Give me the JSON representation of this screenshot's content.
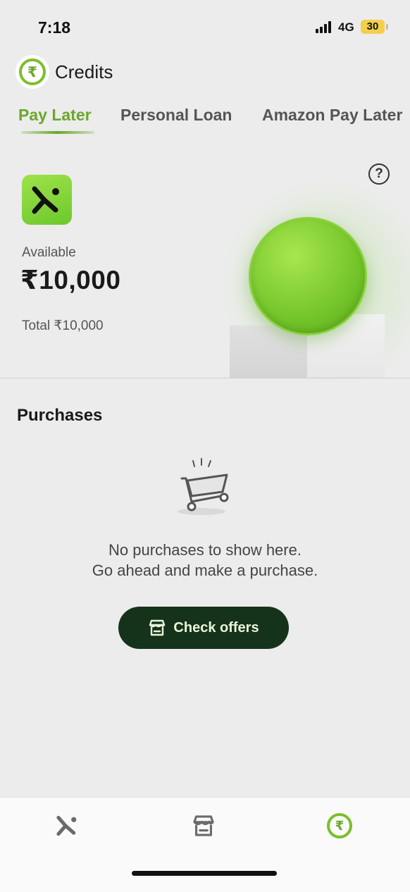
{
  "status_bar": {
    "time": "7:18",
    "network": "4G",
    "battery": "30"
  },
  "header": {
    "title": "Credits",
    "icon": "rupee-coin-icon"
  },
  "tabs": [
    {
      "label": "Pay Later",
      "active": true
    },
    {
      "label": "Personal Loan",
      "active": false
    },
    {
      "label": "Amazon Pay Later",
      "active": false
    }
  ],
  "credit": {
    "available_label": "Available",
    "available_amount": "₹10,000",
    "total_label": "Total ₹10,000",
    "help_glyph": "?"
  },
  "purchases": {
    "title": "Purchases",
    "empty_line1": "No purchases to show here.",
    "empty_line2": "Go ahead and make a purchase.",
    "cta_label": "Check offers"
  },
  "bottom_nav": [
    {
      "name": "brand-home",
      "icon": "brand-x-icon",
      "active": false
    },
    {
      "name": "store",
      "icon": "store-icon",
      "active": false
    },
    {
      "name": "credits",
      "icon": "rupee-coin-icon",
      "active": true
    }
  ],
  "colors": {
    "accent_green": "#6aa72a",
    "button_dark_green": "#15331a",
    "coin_green": "#74c52a",
    "battery_yellow": "#f3cf4a"
  }
}
